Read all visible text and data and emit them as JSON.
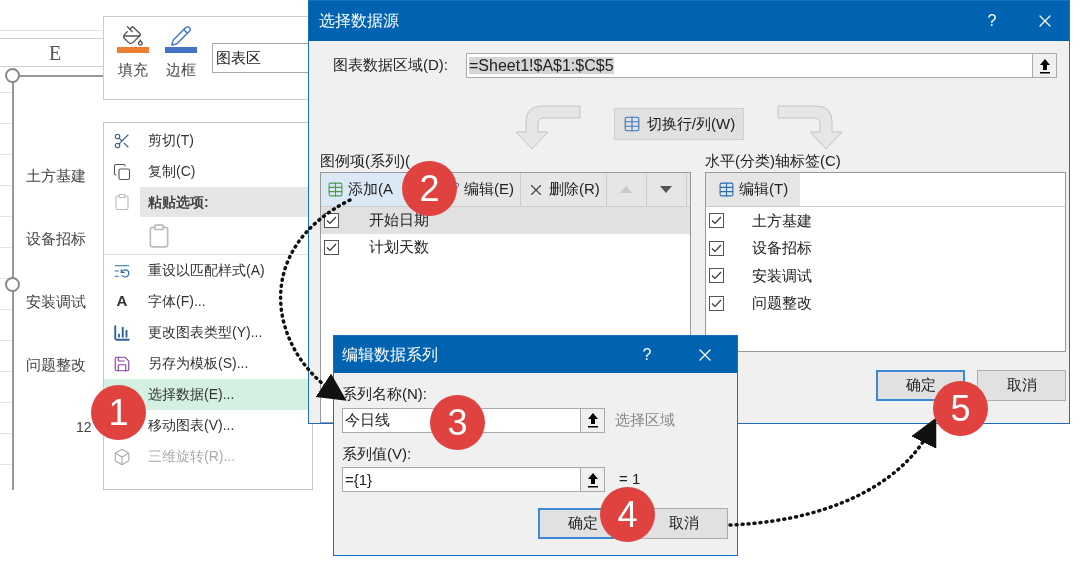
{
  "sheet": {
    "column_header": "E",
    "row_labels": [
      "土方基建",
      "设备招标",
      "安装调试",
      "问题整改"
    ],
    "axis_label": "12"
  },
  "mini_toolbar": {
    "buttons": [
      {
        "label": "填充"
      },
      {
        "label": "边框"
      }
    ],
    "element_field": {
      "value": "图表区"
    }
  },
  "context_menu": {
    "items": [
      {
        "kind": "item",
        "label": "剪切(T)",
        "selected": false,
        "disabled": false
      },
      {
        "kind": "item",
        "label": "复制(C)",
        "selected": false,
        "disabled": false
      },
      {
        "kind": "header",
        "label": "粘贴选项:"
      },
      {
        "kind": "paste"
      },
      {
        "kind": "item",
        "label": "重设以匹配样式(A)",
        "selected": false,
        "disabled": false
      },
      {
        "kind": "item",
        "glyph": "A",
        "label": "字体(F)...",
        "selected": false,
        "disabled": false
      },
      {
        "kind": "item",
        "label": "更改图表类型(Y)...",
        "selected": false,
        "disabled": false
      },
      {
        "kind": "item",
        "label": "另存为模板(S)...",
        "selected": false,
        "disabled": false
      },
      {
        "kind": "item",
        "label": "选择数据(E)...",
        "selected": true,
        "disabled": false
      },
      {
        "kind": "item",
        "label": "移动图表(V)...",
        "selected": false,
        "disabled": false
      },
      {
        "kind": "item",
        "label": "三维旋转(R)...",
        "selected": false,
        "disabled": true
      }
    ]
  },
  "select_data_dialog": {
    "title": "选择数据源",
    "help": "?",
    "range_label": "图表数据区域(D):",
    "range_value": "=Sheet1!$A$1:$C$5",
    "switch_button": "切换行/列(W)",
    "legend": {
      "label": "图例项(系列)(",
      "buttons": [
        {
          "kind": "add",
          "label": "添加(A",
          "selected": true,
          "disabled": false
        },
        {
          "kind": "edit",
          "label": "编辑(E)",
          "selected": false,
          "disabled": false
        },
        {
          "kind": "delete",
          "label": "删除(R)",
          "selected": false,
          "disabled": false
        },
        {
          "kind": "up",
          "selected": false,
          "disabled": true
        },
        {
          "kind": "down",
          "selected": false,
          "disabled": false
        }
      ],
      "series": [
        {
          "name": "开始日期",
          "checked": true,
          "selected": true
        },
        {
          "name": "计划天数",
          "checked": true,
          "selected": false
        }
      ]
    },
    "axis": {
      "label": "水平(分类)轴标签(C)",
      "edit_button": "编辑(T)",
      "categories": [
        {
          "name": "土方基建",
          "checked": true
        },
        {
          "name": "设备招标",
          "checked": true
        },
        {
          "name": "安装调试",
          "checked": true
        },
        {
          "name": "问题整改",
          "checked": true
        }
      ]
    },
    "buttons": [
      {
        "label": "确定",
        "default": true
      },
      {
        "label": "取消",
        "default": false
      }
    ]
  },
  "edit_series_dialog": {
    "title": "编辑数据系列",
    "help": "?",
    "name_label": "系列名称(N):",
    "name_value": "今日线",
    "name_hint": "选择区域",
    "values_label": "系列值(V):",
    "values_value": "={1}",
    "values_result": "= 1",
    "buttons": [
      {
        "label": "确定",
        "default": true
      },
      {
        "label": "取消",
        "default": false
      }
    ]
  },
  "steps": [
    {
      "number": "1"
    },
    {
      "number": "2"
    },
    {
      "number": "3"
    },
    {
      "number": "4"
    },
    {
      "number": "5"
    }
  ]
}
